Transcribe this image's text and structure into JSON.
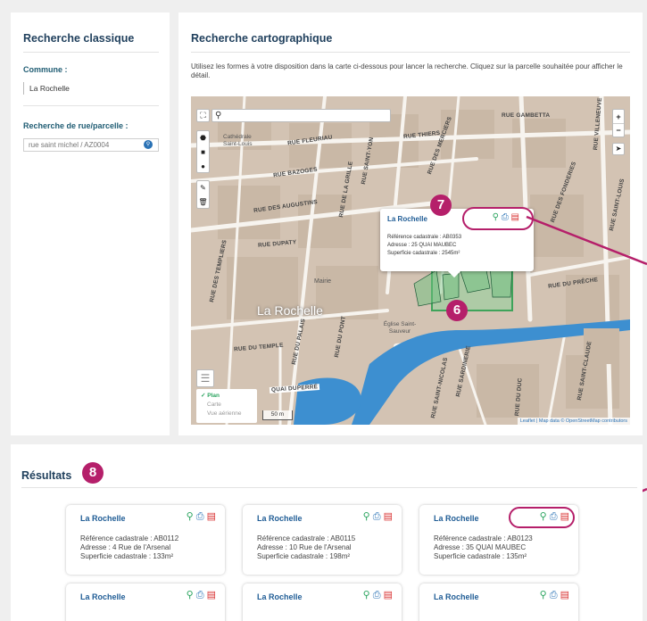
{
  "left": {
    "title": "Recherche classique",
    "commune_label": "Commune :",
    "commune_value": "La Rochelle",
    "rue_label": "Recherche de rue/parcelle :",
    "rue_placeholder": "rue saint michel / AZ0004"
  },
  "mid": {
    "title": "Recherche cartographique",
    "intro": "Utilisez les formes à votre disposition dans la carte ci-dessous pour lancer la recherche. Cliquez sur la parcelle souhaitée pour afficher le détail."
  },
  "map": {
    "city_label": "La Rochelle",
    "streets": [
      "RUE GAMBETTA",
      "RUE THIERS",
      "RUE FLEURIAU",
      "RUE BAZOGES",
      "RUE DES AUGUSTINS",
      "RUE DUPATY",
      "RUE DES TEMPLIERS",
      "RUE DU TEMPLE",
      "RUE DU PALAIS",
      "RUE DU PONT",
      "QUAI DUPERRÉ",
      "RUE DU PRÊCHE",
      "RUE SAINT-LOUIS",
      "RUE VILLENEUVE",
      "RUE DES FONDERIES",
      "RUE DES MERCIERS",
      "RUE SAINT-YON",
      "RUE DE LA GRILLE",
      "RUE SAINT-NICOLAS",
      "RUE SARDINERIE",
      "RUE DU DUC",
      "RUE SAINT-CLAUDE",
      "RUE BAZOGES"
    ],
    "landmarks": [
      "Cathédrale Saint-Louis",
      "Mairie",
      "Église Saint-Sauveur"
    ],
    "layers": [
      "Plan",
      "Carte",
      "Vue aérienne"
    ],
    "scale": "50 m",
    "zoom_in": "+",
    "zoom_out": "−",
    "attribution": "Leaflet | Map data © OpenStreetMap contributors",
    "popup": {
      "title": "La Rochelle",
      "ref": "Référence cadastrale : AB0353",
      "adresse": "Adresse : 25 QUAI MAUBEC",
      "superficie": "Superficie cadastrale : 2545m²"
    },
    "badges": [
      "7",
      "6"
    ]
  },
  "results": {
    "title": "Résultats",
    "badge": "8",
    "cards": [
      {
        "title": "La Rochelle",
        "ref": "Référence cadastrale : AB0112",
        "adresse": "Adresse : 4 Rue de l'Arsenal",
        "superficie": "Superficie cadastrale : 133m²"
      },
      {
        "title": "La Rochelle",
        "ref": "Référence cadastrale : AB0115",
        "adresse": "Adresse : 10 Rue de l'Arsenal",
        "superficie": "Superficie cadastrale : 198m²"
      },
      {
        "title": "La Rochelle",
        "ref": "Référence cadastrale : AB0123",
        "adresse": "Adresse : 35 QUAI MAUBEC",
        "superficie": "Superficie cadastrale : 135m²"
      },
      {
        "title": "La Rochelle"
      },
      {
        "title": "La Rochelle"
      },
      {
        "title": "La Rochelle"
      }
    ]
  },
  "colors": {
    "accent": "#b51f6a",
    "title": "#1f3f5c",
    "link": "#1f5c95",
    "water": "#3d8fd0",
    "parcel": "#3fa35a"
  },
  "icons": [
    "search-icon",
    "print-icon",
    "pdf-icon",
    "fullscreen-icon",
    "polygon-icon",
    "square-icon",
    "circle-icon",
    "edit-icon",
    "trash-icon",
    "layers-icon",
    "locate-icon"
  ]
}
